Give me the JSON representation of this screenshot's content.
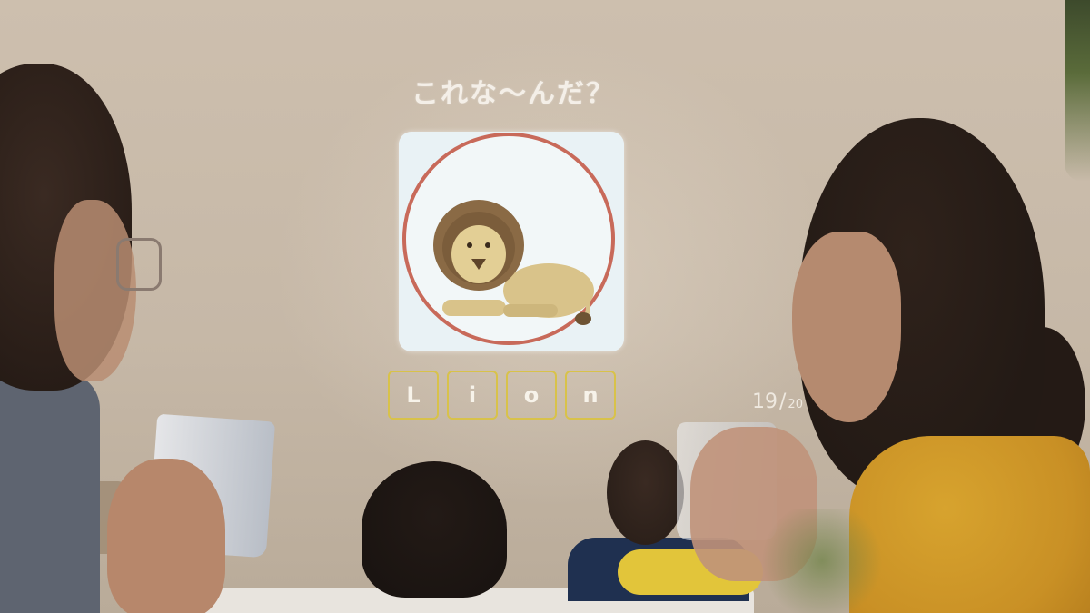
{
  "quiz": {
    "question": "これな〜んだ？",
    "image_icon": "lion-icon",
    "answer_letters": [
      "L",
      "i",
      "o",
      "n"
    ],
    "progress": {
      "current": "19",
      "separator": "/",
      "total": "20"
    }
  },
  "colors": {
    "card_background": "#e9f2f5",
    "ring": "#c86a5a",
    "tile_border": "#d8c24a",
    "lion_mane": "#8a6a45",
    "lion_body": "#d9c38a",
    "woman_sweater": "#d7a32e"
  }
}
